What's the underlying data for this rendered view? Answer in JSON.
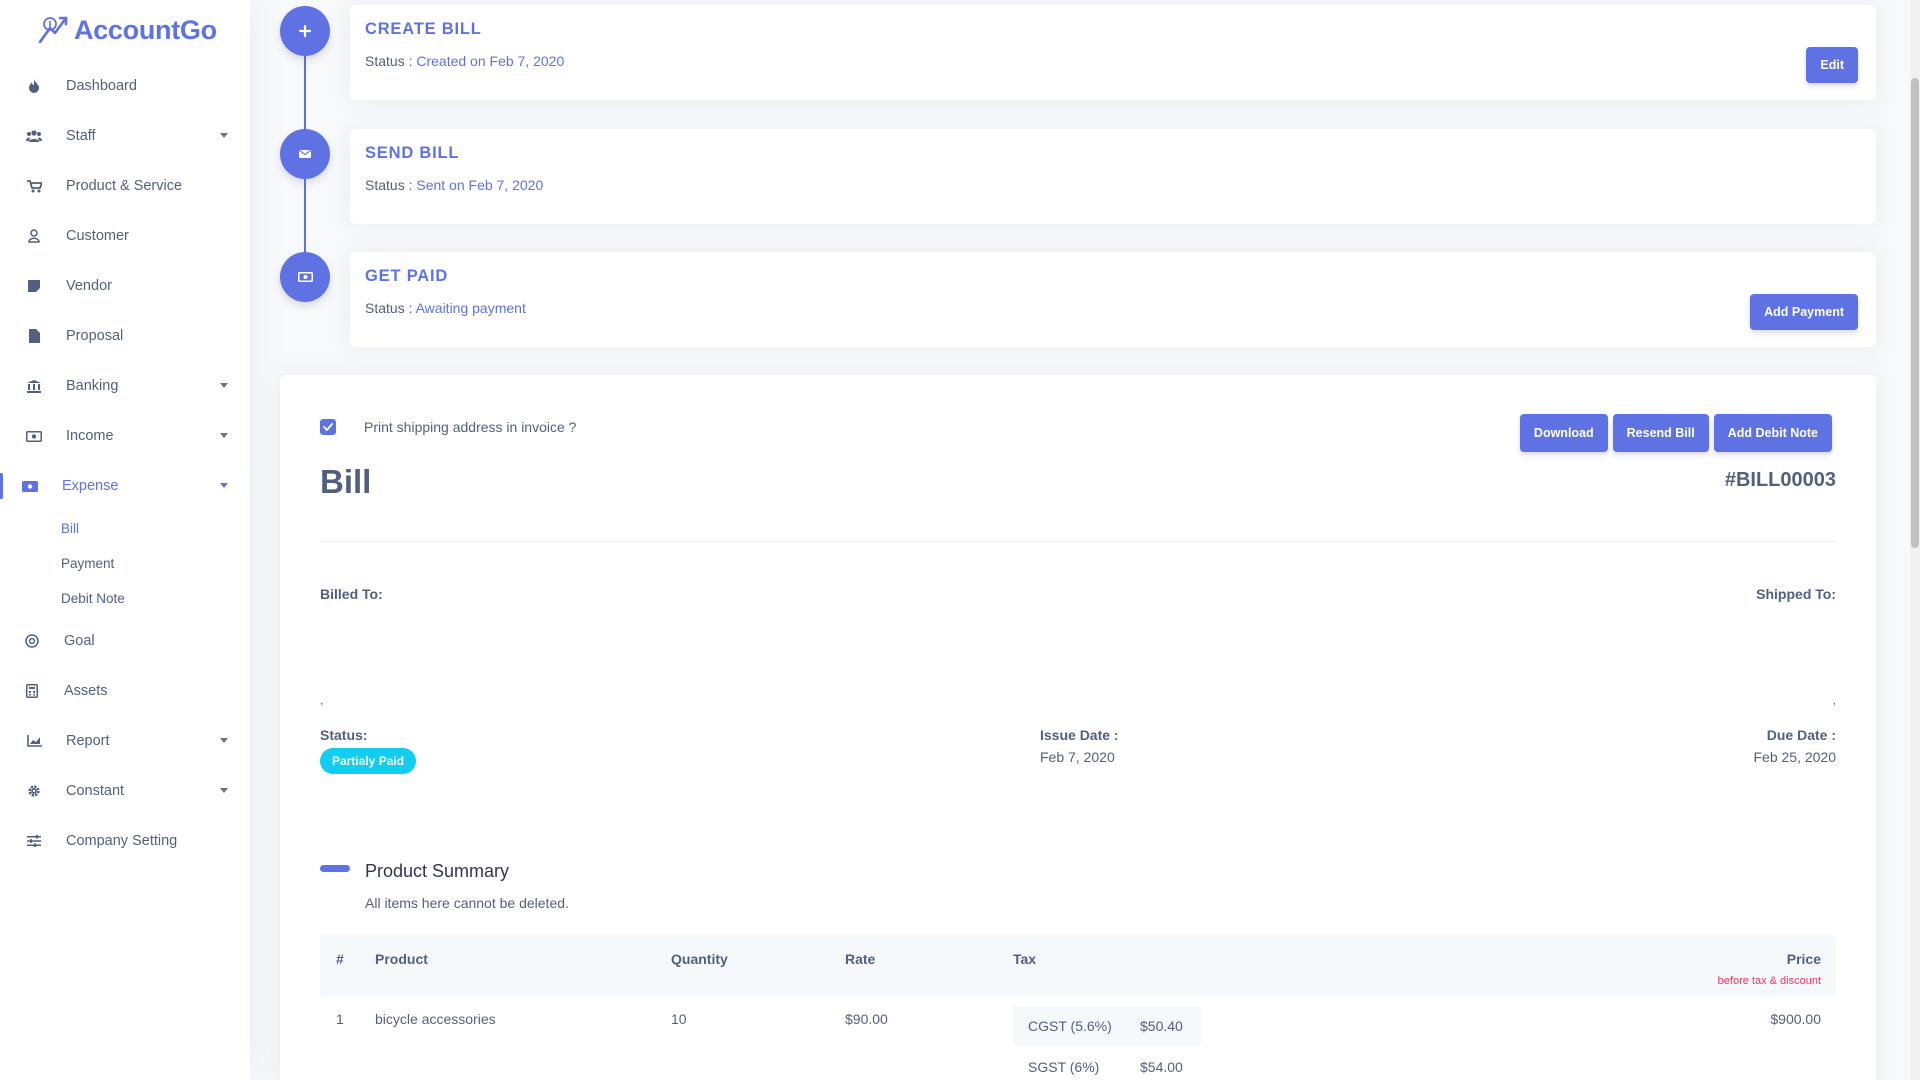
{
  "brand": {
    "name": "AccountGo"
  },
  "colors": {
    "primary": "#5e72e4",
    "info": "#11cdef",
    "danger": "#f5365c",
    "text": "#525f7f"
  },
  "sidebar": {
    "items": [
      {
        "label": "Dashboard",
        "icon": "fire-icon"
      },
      {
        "label": "Staff",
        "icon": "users-icon"
      },
      {
        "label": "Product & Service",
        "icon": "cart-icon"
      },
      {
        "label": "Customer",
        "icon": "user-icon"
      },
      {
        "label": "Vendor",
        "icon": "note-icon"
      },
      {
        "label": "Proposal",
        "icon": "file-icon"
      },
      {
        "label": "Banking",
        "icon": "bank-icon"
      },
      {
        "label": "Income",
        "icon": "money-icon"
      },
      {
        "label": "Expense",
        "icon": "money-bill-icon"
      },
      {
        "label": "Goal",
        "icon": "target-icon"
      },
      {
        "label": "Assets",
        "icon": "calculator-icon"
      },
      {
        "label": "Report",
        "icon": "chart-icon"
      },
      {
        "label": "Constant",
        "icon": "gear-icon"
      },
      {
        "label": "Company Setting",
        "icon": "sliders-icon"
      }
    ],
    "expense_sub": [
      "Bill",
      "Payment",
      "Debit Note"
    ]
  },
  "timeline": [
    {
      "title": "CREATE BILL",
      "status_label": "Status : ",
      "status_value": "Created on Feb 7, 2020",
      "button": "Edit"
    },
    {
      "title": "SEND BILL",
      "status_label": "Status : ",
      "status_value": "Sent on Feb 7, 2020"
    },
    {
      "title": "GET PAID",
      "status_label": "Status : ",
      "status_value": "Awaiting payment",
      "button": "Add Payment"
    }
  ],
  "bill": {
    "checkbox_label": "Print shipping address in invoice ?",
    "actions": [
      "Download",
      "Resend Bill",
      "Add Debit Note"
    ],
    "heading": "Bill",
    "number": "#BILL00003",
    "billed_to_label": "Billed To:",
    "shipped_to_label": "Shipped To:",
    "billed_to_value": ",",
    "shipped_to_value": ",",
    "status_label": "Status:",
    "status_value": "Partialy Paid",
    "issue_date_label": "Issue Date :",
    "issue_date_value": "Feb 7, 2020",
    "due_date_label": "Due Date :",
    "due_date_value": "Feb 25, 2020"
  },
  "product_summary": {
    "title": "Product Summary",
    "subtitle": "All items here cannot be deleted.",
    "headers": {
      "num": "#",
      "product": "Product",
      "quantity": "Quantity",
      "rate": "Rate",
      "tax": "Tax",
      "price": "Price",
      "price_note": "before tax & discount"
    },
    "rows": [
      {
        "num": "1",
        "product": "bicycle accessories",
        "quantity": "10",
        "rate": "$90.00",
        "taxes": [
          {
            "name": "CGST (5.6%)",
            "amount": "$50.40"
          },
          {
            "name": "SGST (6%)",
            "amount": "$54.00"
          }
        ],
        "price": "$900.00"
      }
    ]
  }
}
